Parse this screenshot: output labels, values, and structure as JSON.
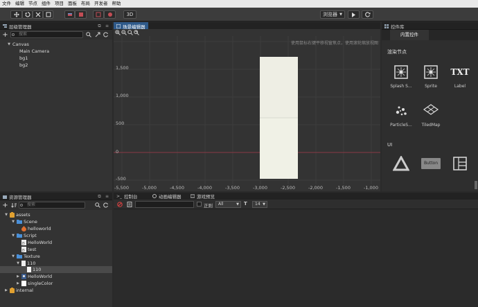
{
  "menu": [
    "文件",
    "编辑",
    "节点",
    "组件",
    "项目",
    "面板",
    "布局",
    "开发者",
    "帮助"
  ],
  "toolbar": {
    "btn_3d": "3D",
    "browser_select": "浏览器"
  },
  "hierarchy": {
    "tab": "层级管理器",
    "search_placeholder": "搜索",
    "nodes": [
      "Canvas",
      "Main Camera",
      "bg1",
      "bg2"
    ]
  },
  "scene": {
    "tab": "场景编辑器",
    "hint": "使用鼠标右键平移视窗焦点，使用滚轮缩放视图",
    "y_labels": [
      "1,500",
      "1,000",
      "500",
      "0",
      "-500"
    ],
    "x_labels": [
      "-5,500",
      "-5,000",
      "-4,500",
      "-4,000",
      "-3,500",
      "-3,000",
      "-2,500",
      "-2,000",
      "-1,500",
      "-1,000"
    ]
  },
  "library": {
    "tab": "控件库",
    "subtab": "内置控件",
    "section_render": "渲染节点",
    "items_row1": [
      "Splash S...",
      "Sprite",
      "Label"
    ],
    "label_icon_text": "TXT",
    "items_row2": [
      "ParticleS...",
      "TiledMap"
    ],
    "section_ui": "UI",
    "button_icon_text": "Button"
  },
  "assets": {
    "tab": "资源管理器",
    "search_placeholder": "搜索",
    "tree": [
      "assets",
      "Scene",
      "helloworld",
      "Script",
      "HelloWorld",
      "test",
      "Texture",
      "110",
      "110",
      "HelloWorld",
      "singleColor",
      "internal"
    ]
  },
  "bottom_tabs": [
    "控制台",
    "动画编辑器",
    "游戏预览"
  ],
  "console": {
    "regex_label": "正则",
    "filter_value": "All",
    "font_size_value": "14"
  },
  "colors": {
    "accent": "#2f5a8a",
    "grid": "#3d3d3d",
    "x_axis": "#8a3a45",
    "folder": "#4a90d9",
    "assets_root": "#e0a030"
  }
}
